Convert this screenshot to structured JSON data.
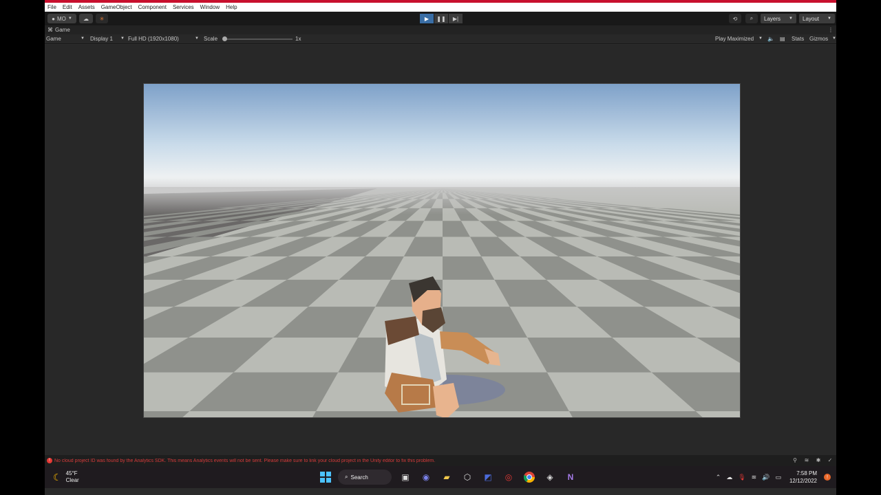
{
  "menu": [
    "File",
    "Edit",
    "Assets",
    "GameObject",
    "Component",
    "Services",
    "Window",
    "Help"
  ],
  "toolbar": {
    "account_label": "MO",
    "layers_label": "Layers",
    "layout_label": "Layout"
  },
  "tab": {
    "title": "Game"
  },
  "gamebar": {
    "mode": "Game",
    "display": "Display 1",
    "resolution": "Full HD (1920x1080)",
    "scale_label": "Scale",
    "scale_value": "1x",
    "play_mode": "Play Maximized",
    "stats": "Stats",
    "gizmos": "Gizmos"
  },
  "console": {
    "message": "No cloud project ID was found by the Analytics SDK. This means Analytics events will not be sent. Please make sure to link your cloud project in the Unity editor to fix this problem."
  },
  "taskbar": {
    "temperature": "45°F",
    "condition": "Clear",
    "search_label": "Search",
    "time": "7:58 PM",
    "date": "12/12/2022"
  },
  "colors": {
    "menu_accent": "#c8102e",
    "play_active": "#3a6ea5",
    "error": "#d73b3b"
  }
}
